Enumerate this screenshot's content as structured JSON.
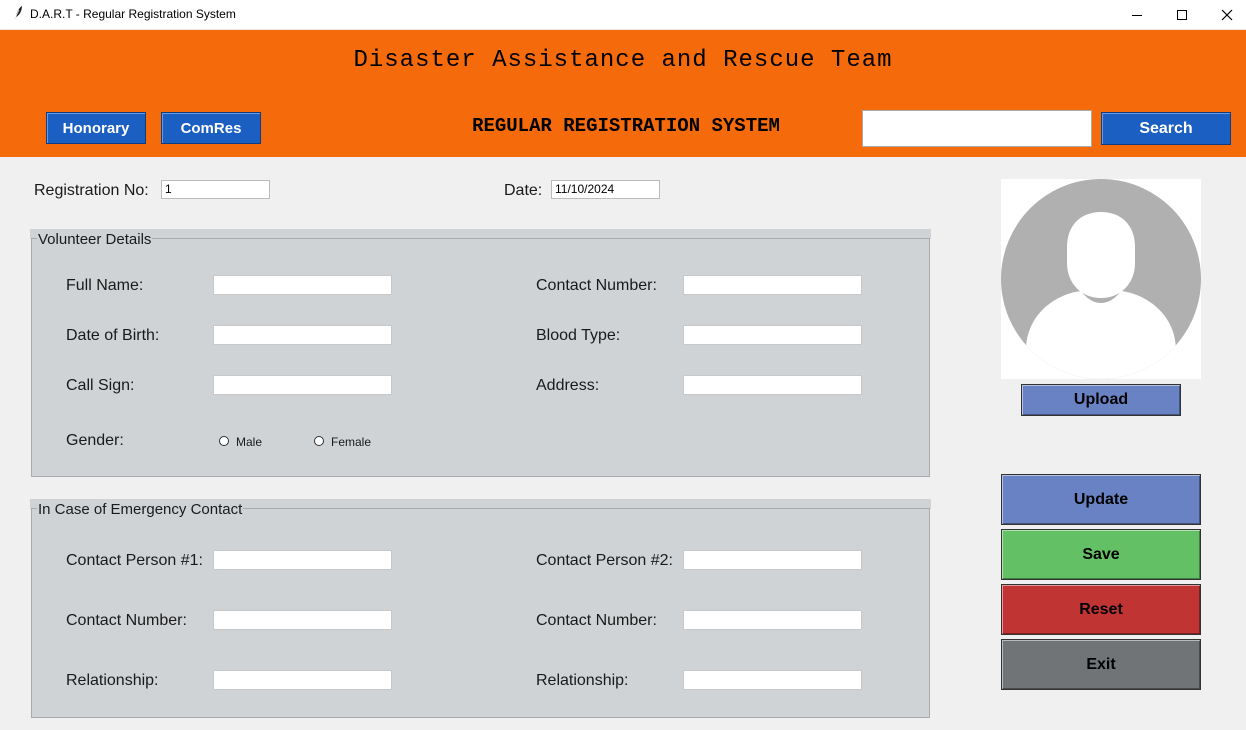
{
  "window": {
    "title": "D.A.R.T - Regular Registration System"
  },
  "header": {
    "org_title": "Disaster Assistance and Rescue Team",
    "system_title": "REGULAR REGISTRATION SYSTEM",
    "honorary_label": "Honorary",
    "comres_label": "ComRes",
    "search_label": "Search",
    "search_value": ""
  },
  "top": {
    "reg_label": "Registration No:",
    "reg_value": "1",
    "date_label": "Date:",
    "date_value": "11/10/2024"
  },
  "volunteer": {
    "title": "Volunteer Details",
    "full_name_label": "Full Name:",
    "dob_label": "Date of Birth:",
    "call_sign_label": "Call Sign:",
    "gender_label": "Gender:",
    "male_label": "Male",
    "female_label": "Female",
    "contact_number_label": "Contact Number:",
    "blood_type_label": "Blood Type:",
    "address_label": "Address:"
  },
  "emergency": {
    "title": "In Case of Emergency Contact",
    "person1_label": "Contact Person #1:",
    "contact_number1_label": "Contact Number:",
    "relationship1_label": "Relationship:",
    "person2_label": "Contact Person #2:",
    "contact_number2_label": "Contact Number:",
    "relationship2_label": "Relationship:"
  },
  "photo": {
    "upload_label": "Upload"
  },
  "actions": {
    "update_label": "Update",
    "save_label": "Save",
    "reset_label": "Reset",
    "exit_label": "Exit"
  },
  "colors": {
    "header": "#f56a0b",
    "header_button": "#1a5fc1",
    "update": "#6882c4",
    "save": "#64c064",
    "reset": "#c03434",
    "exit": "#717477",
    "group_bg": "#cfd3d6"
  },
  "icons": {
    "app": "feather-icon",
    "minimize": "minimize-icon",
    "maximize": "maximize-icon",
    "close": "close-icon",
    "avatar": "user-silhouette-icon"
  }
}
